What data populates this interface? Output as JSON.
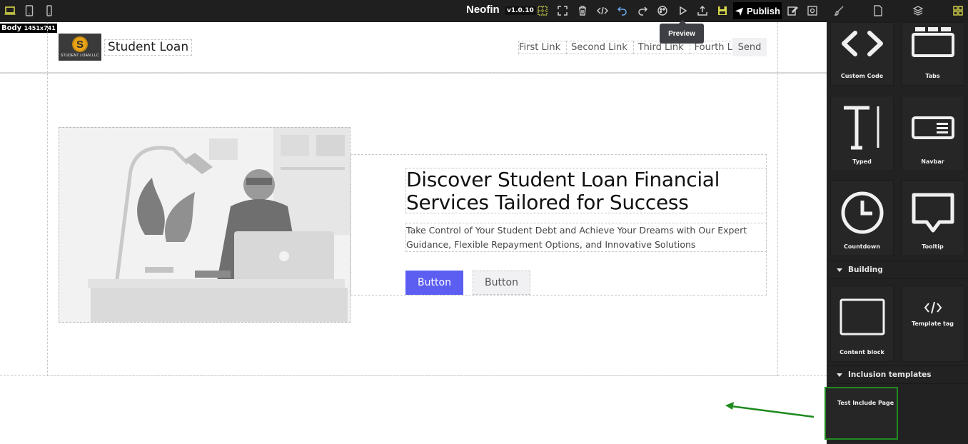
{
  "toolbar": {
    "brand": "Neofin",
    "version": "v1.0.10",
    "publish_label": "Publish",
    "preview_tooltip": "Preview",
    "device_icons": [
      "desktop-icon",
      "tablet-icon",
      "mobile-icon"
    ],
    "action_icons": [
      "grid-icon",
      "fullscreen-icon",
      "trash-icon",
      "code-icon",
      "undo-icon",
      "redo-icon",
      "palette-icon",
      "play-icon",
      "export-icon",
      "save-icon",
      "edit-icon",
      "page-settings-icon"
    ],
    "panel_icons": [
      "brush-icon",
      "page-icon",
      "layers-icon",
      "blocks-icon"
    ]
  },
  "canvas": {
    "body_badge": "Body",
    "body_size": "1451x741",
    "header": {
      "logo_letter": "S",
      "logo_caption": "STUDENT LOAN LLC",
      "site_title": "Student Loan",
      "nav_links": [
        "First Link",
        "Second Link",
        "Third Link",
        "Fourth Link"
      ],
      "send_label": "Send"
    },
    "hero": {
      "headline": "Discover Student Loan Financial Services Tailored for Success",
      "subtext": "Take Control of Your Student Debt and Achieve Your Dreams with Our Expert Guidance, Flexible Repayment Options, and Innovative Solutions",
      "primary_button": "Button",
      "secondary_button": "Button"
    }
  },
  "panel": {
    "blocks_top": [
      {
        "label": "Custom Code",
        "icon": "code-brackets-icon"
      },
      {
        "label": "Tabs",
        "icon": "tabs-icon"
      },
      {
        "label": "Typed",
        "icon": "typed-icon"
      },
      {
        "label": "Navbar",
        "icon": "navbar-icon"
      },
      {
        "label": "Countdown",
        "icon": "clock-icon"
      },
      {
        "label": "Tooltip",
        "icon": "tooltip-icon"
      }
    ],
    "section_building": "Building",
    "blocks_building": [
      {
        "label": "Content block",
        "icon": "content-block-icon"
      },
      {
        "label": "Template tag",
        "icon": "template-tag-icon"
      }
    ],
    "section_inclusion": "Inclusion templates",
    "inclusion_items": [
      {
        "label": "Test Include Page"
      }
    ]
  },
  "annotation": {
    "arrow_color": "#1f8a1f"
  },
  "colors": {
    "primary_button": "#5b5ef0",
    "panel_bg": "#222222",
    "toolbar_bg": "#1f1f1f",
    "highlight_icon": "#d8d84a"
  }
}
